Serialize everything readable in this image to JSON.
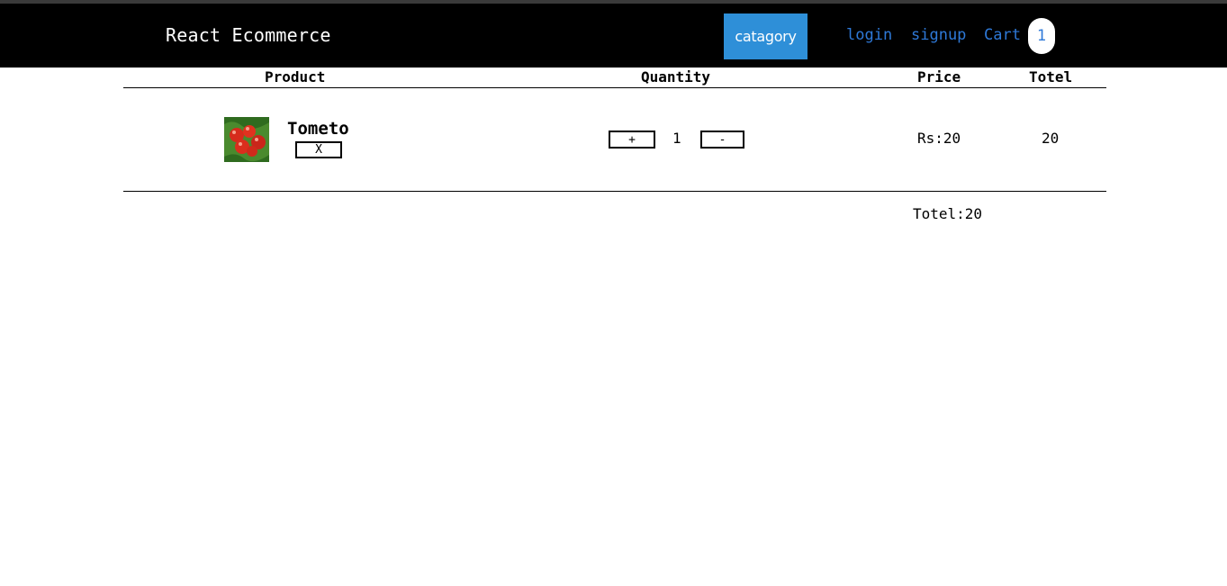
{
  "navbar": {
    "brand": "React Ecommerce",
    "category_label": "catagory",
    "login_label": "login",
    "signup_label": "signup",
    "cart_label": "Cart",
    "cart_count": "1"
  },
  "colors": {
    "navbar_bg": "#000000",
    "accent": "#2e8fd8",
    "link": "#2e79d8"
  },
  "cart_table": {
    "headers": [
      "Product",
      "Quantity",
      "Price",
      "Totel"
    ],
    "rows": [
      {
        "image_icon": "tomato-image",
        "name": "Tometo",
        "remove_label": "X",
        "increment_label": "+",
        "quantity": "1",
        "decrement_label": "-",
        "price": "Rs:20",
        "total": "20"
      }
    ],
    "grand_total": "Totel:20"
  }
}
